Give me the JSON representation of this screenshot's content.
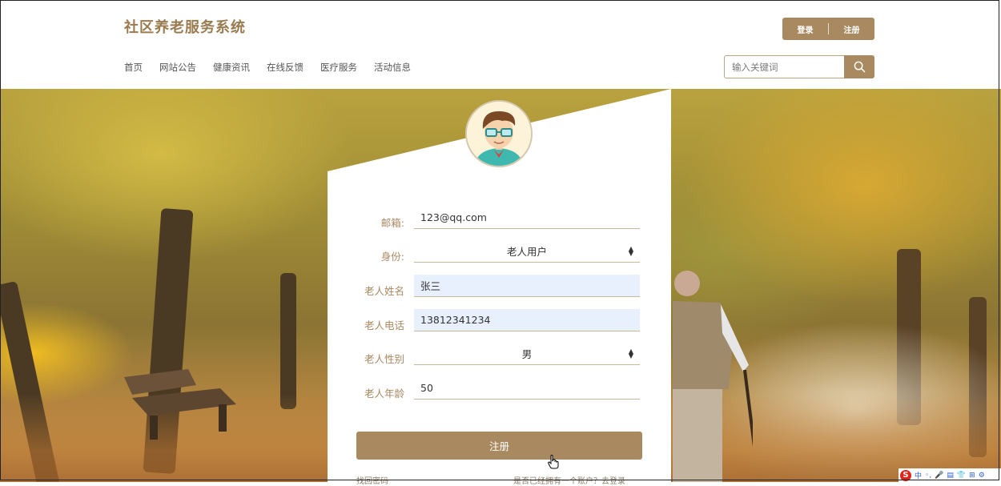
{
  "header": {
    "site_title": "社区养老服务系统",
    "login_label": "登录",
    "register_label": "注册",
    "nav": [
      "首页",
      "网站公告",
      "健康资讯",
      "在线反馈",
      "医疗服务",
      "活动信息"
    ],
    "search_placeholder": "输入关键词"
  },
  "form": {
    "fields": [
      {
        "label": "邮箱:",
        "value": "123@qq.com"
      },
      {
        "label": "身份:",
        "value": "老人用户"
      },
      {
        "label": "老人姓名",
        "value": "张三"
      },
      {
        "label": "老人电话",
        "value": "13812341234"
      },
      {
        "label": "老人性别",
        "value": "男"
      },
      {
        "label": "老人年龄",
        "value": "50"
      }
    ],
    "submit_label": "注册",
    "forgot_label": "找回密码",
    "login_prompt": "是否已经拥有一个账户？去登录"
  },
  "ime_bar": {
    "lang": "中"
  },
  "colors": {
    "brand": "#a98a60",
    "title": "#9a7b4f",
    "label": "#a88860",
    "autofill": "#e8f0fe"
  }
}
